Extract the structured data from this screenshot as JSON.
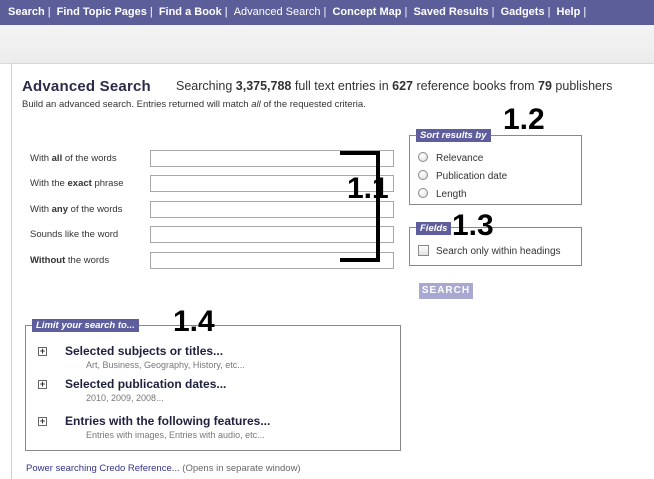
{
  "topnav": {
    "items": [
      "Search",
      "Find Topic Pages",
      "Find a Book",
      "Advanced Search",
      "Concept Map",
      "Saved Results",
      "Gadgets",
      "Help"
    ]
  },
  "header": {
    "title": "Advanced Search",
    "stats": {
      "prefix": "Searching ",
      "entries": "3,375,788",
      "mid1": " full text entries in ",
      "books": "627",
      "mid2": " reference books from ",
      "publishers": "79",
      "suffix": " publishers"
    },
    "subtitle": {
      "before": "Build an advanced search. Entries returned will match ",
      "emph": "all",
      "after": " of the requested criteria."
    }
  },
  "fields": [
    {
      "pre": "With ",
      "bold": "all",
      "post": " of the words",
      "value": ""
    },
    {
      "pre": "With the ",
      "bold": "exact",
      "post": " phrase",
      "value": ""
    },
    {
      "pre": "With ",
      "bold": "any",
      "post": " of the words",
      "value": ""
    },
    {
      "pre": "Sounds like the word",
      "bold": "",
      "post": "",
      "value": ""
    },
    {
      "pre": "",
      "bold": "Without",
      "post": " the words",
      "value": ""
    }
  ],
  "sort": {
    "legend": "Sort results by",
    "options": [
      "Relevance",
      "Publication date",
      "Length"
    ]
  },
  "fieldsbox": {
    "legend": "Fields",
    "option": "Search only within headings"
  },
  "search_button": "SEARCH",
  "limit": {
    "legend": "Limit your search to...",
    "items": [
      {
        "expander": "+",
        "title": "Selected subjects or titles...",
        "sub": "Art, Business, Geography, History, etc..."
      },
      {
        "expander": "+",
        "title": "Selected publication dates...",
        "sub": "2010, 2009, 2008..."
      },
      {
        "expander": "+",
        "title": "Entries with the following features...",
        "sub": "Entries with images, Entries with audio, etc..."
      }
    ]
  },
  "footer": {
    "link": "Power searching Credo Reference...",
    "note": " (Opens in separate window)"
  },
  "annotations": {
    "a11": "1.1",
    "a12": "1.2",
    "a13": "1.3",
    "a14": "1.4"
  }
}
